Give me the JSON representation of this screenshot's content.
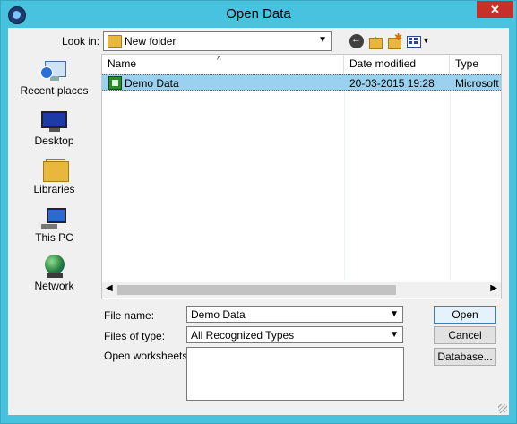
{
  "window": {
    "title": "Open Data",
    "close_label": "✕"
  },
  "toolbar": {
    "lookin_label": "Look in:",
    "lookin_value": "New folder"
  },
  "places": [
    {
      "label": "Recent places",
      "icon": "recent-places-icon"
    },
    {
      "label": "Desktop",
      "icon": "desktop-icon"
    },
    {
      "label": "Libraries",
      "icon": "libraries-icon"
    },
    {
      "label": "This PC",
      "icon": "this-pc-icon"
    },
    {
      "label": "Network",
      "icon": "network-icon"
    }
  ],
  "list": {
    "columns": [
      "Name",
      "Date modified",
      "Type"
    ],
    "rows": [
      {
        "name": "Demo Data",
        "date": "20-03-2015 19:28",
        "type": "Microsoft"
      }
    ]
  },
  "form": {
    "filename_label": "File name:",
    "filename_value": "Demo Data",
    "filetype_label": "Files of type:",
    "filetype_value": "All Recognized Types",
    "worksheets_label": "Open worksheets:"
  },
  "buttons": {
    "open": "Open",
    "cancel": "Cancel",
    "database": "Database..."
  },
  "colors": {
    "frame": "#47c2df",
    "selection": "#99d1ef",
    "close": "#c7302a"
  }
}
